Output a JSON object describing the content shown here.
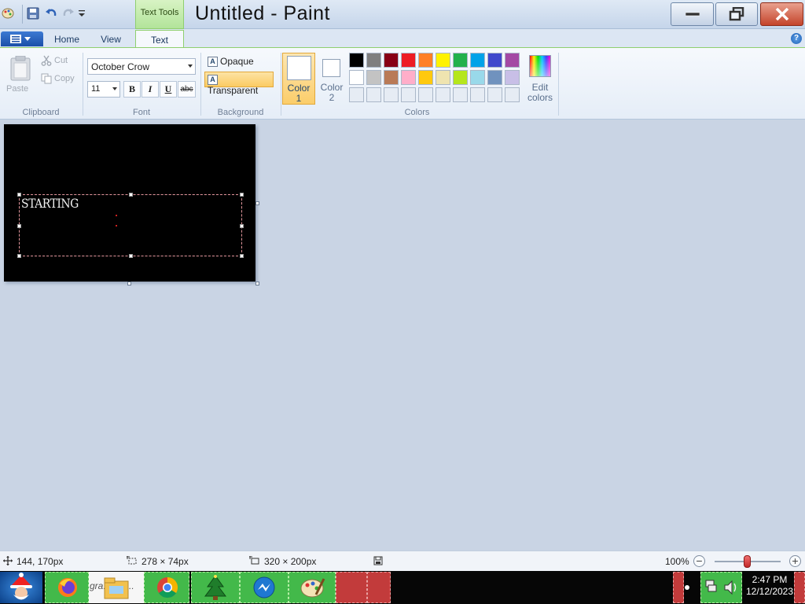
{
  "window": {
    "title": "Untitled - Paint",
    "context_tab": "Text Tools"
  },
  "tabs": {
    "home": "Home",
    "view": "View",
    "text": "Text"
  },
  "ribbon": {
    "clipboard": {
      "paste": "Paste",
      "cut": "Cut",
      "copy": "Copy",
      "label": "Clipboard"
    },
    "font": {
      "family": "October Crow",
      "size": "11",
      "bold": "B",
      "italic": "I",
      "underline": "U",
      "strikethrough": "abc",
      "label": "Font"
    },
    "background": {
      "opaque": "Opaque",
      "transparent": "Transparent",
      "label": "Background"
    },
    "colors": {
      "color1_line1": "Color",
      "color1_line2": "1",
      "color2_line1": "Color",
      "color2_line2": "2",
      "edit_line1": "Edit",
      "edit_line2": "colors",
      "label": "Colors",
      "color1_value": "#ffffff",
      "color2_value": "#ffffff",
      "palette_row1": [
        "#000000",
        "#7f7f7f",
        "#880015",
        "#ed1c24",
        "#ff7f27",
        "#fff200",
        "#22b14c",
        "#00a2e8",
        "#3f48cc",
        "#a349a4"
      ],
      "palette_row2": [
        "#ffffff",
        "#c3c3c3",
        "#b97a57",
        "#ffaec9",
        "#ffc90e",
        "#efe4b0",
        "#b5e61d",
        "#99d9ea",
        "#7092be",
        "#c8bfe7"
      ]
    }
  },
  "canvas": {
    "text": "STARTING",
    "background": "#000000"
  },
  "status": {
    "cursor_pos": "144, 170px",
    "selection_size": "278 × 74px",
    "canvas_size": "320 × 200px",
    "zoom": "100%",
    "zoom_minus": "−",
    "zoom_plus": "+"
  },
  "taskbar": {
    "explorer_text": "gra... d fi...",
    "time": "2:47 PM",
    "date": "12/12/2023"
  },
  "icons": {
    "help": "?"
  }
}
